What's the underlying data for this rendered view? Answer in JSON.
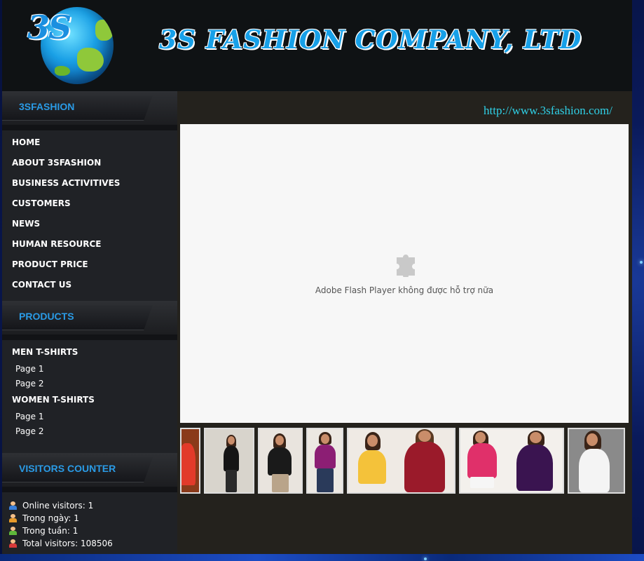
{
  "header": {
    "logo_text": "3S",
    "company_title": "3S FASHION COMPANY, LTD"
  },
  "sidebar": {
    "section1_title": "3SFASHION",
    "menu": [
      "HOME",
      "ABOUT 3SFASHION",
      "BUSINESS ACTIVITIVES",
      "CUSTOMERS",
      "NEWS",
      "HUMAN RESOURCE",
      "PRODUCT PRICE",
      "CONTACT US"
    ],
    "section2_title": "PRODUCTS",
    "products": {
      "men": {
        "label": "MEN T-SHIRTS",
        "pages": [
          "Page 1",
          "Page 2"
        ]
      },
      "women": {
        "label": "WOMEN T-SHIRTS",
        "pages": [
          "Page 1",
          "Page 2"
        ]
      }
    },
    "section3_title": "VISITORS COUNTER",
    "visitors": [
      "Online visitors: 1",
      "Trong ngày: 1",
      "Trong tuần: 1",
      "Total visitors: 108506"
    ]
  },
  "main": {
    "url": "http://www.3sfashion.com/",
    "flash_message": "Adobe Flash Player không được hỗ trợ nữa",
    "plugin_icon": "puzzle-piece-icon"
  },
  "colors": {
    "accent_blue": "#2a9be6",
    "url_cyan": "#2fd0e6",
    "title_blue": "#17a0e8"
  }
}
